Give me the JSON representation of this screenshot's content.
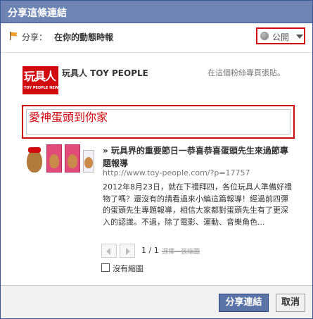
{
  "dialog": {
    "title": "分享這條連結"
  },
  "share": {
    "label": "分享：",
    "target": "在你的動態時報",
    "privacy": "公開"
  },
  "page": {
    "logo_text": "玩具人",
    "logo_subtext": "TOY PEOPLE NEWS",
    "name": "玩具人 TOY PEOPLE",
    "post_note": "在這個粉絲專頁張貼。"
  },
  "message": {
    "value": "愛神蛋頭到你家"
  },
  "link": {
    "title": "» 玩具界的重要節日一恭喜恭喜蛋頭先生來過節專題報導",
    "url": "http://www.toy-people.com/?p=17757",
    "description": "2012年8月23日，就在下禮拜四，各位玩具人準備好禮物了嗎？還沒有的請看過來小編這篇報導！經過前四彈的蛋頭先生專題報導，相信大家都對蛋頭先生有了更深入的認識。不過，除了電影、運動、音樂角色..."
  },
  "pager": {
    "count": "1 / 1",
    "choose": "選擇一張縮圖"
  },
  "no_thumbnail": {
    "label": "沒有縮圖"
  },
  "footer": {
    "share_button": "分享連結",
    "cancel_button": "取消"
  },
  "colors": {
    "title_bar": "#6d84b4",
    "highlight": "#d10a10",
    "brand": "#3b5998"
  }
}
